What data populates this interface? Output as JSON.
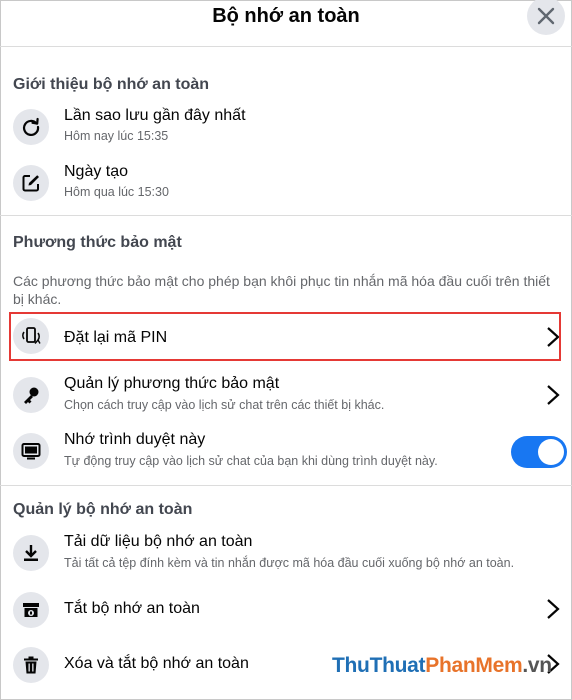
{
  "header": {
    "title": "Bộ nhớ an toàn"
  },
  "sections": {
    "intro": {
      "title": "Giới thiệu bộ nhớ an toàn",
      "items": [
        {
          "title": "Lần sao lưu gần đây nhất",
          "subtitle": "Hôm nay lúc 15:35",
          "icon": "refresh-icon"
        },
        {
          "title": "Ngày tạo",
          "subtitle": "Hôm qua lúc 15:30",
          "icon": "edit-icon"
        }
      ]
    },
    "security": {
      "title": "Phương thức bảo mật",
      "description": "Các phương thức bảo mật cho phép bạn khôi phục tin nhắn mã hóa đầu cuối trên thiết bị khác.",
      "items": [
        {
          "title": "Đặt lại mã PIN",
          "icon": "device-reset-icon",
          "highlighted": true
        },
        {
          "title": "Quản lý phương thức bảo mật",
          "subtitle": "Chọn cách truy cập vào lịch sử chat trên các thiết bị khác.",
          "icon": "key-icon"
        },
        {
          "title": "Nhớ trình duyệt này",
          "subtitle": "Tự động truy cập vào lịch sử chat của bạn khi dùng trình duyệt này.",
          "icon": "monitor-icon",
          "toggle_on": true
        }
      ]
    },
    "manage": {
      "title": "Quản lý bộ nhớ an toàn",
      "items": [
        {
          "title": "Tải dữ liệu bộ nhớ an toàn",
          "subtitle": "Tải tất cả tệp đính kèm và tin nhắn được mã hóa đầu cuối xuống bộ nhớ an toàn.",
          "icon": "download-icon"
        },
        {
          "title": "Tắt bộ nhớ an toàn",
          "icon": "storage-off-icon"
        },
        {
          "title": "Xóa và tắt bộ nhớ an toàn",
          "icon": "trash-icon"
        }
      ]
    }
  },
  "watermark": {
    "part1": "ThuThuat",
    "part2": "PhanMem",
    "part3": ".vn"
  },
  "colors": {
    "accent": "#1877f2",
    "highlight": "#e53935",
    "icon_bg": "#e4e6eb"
  }
}
